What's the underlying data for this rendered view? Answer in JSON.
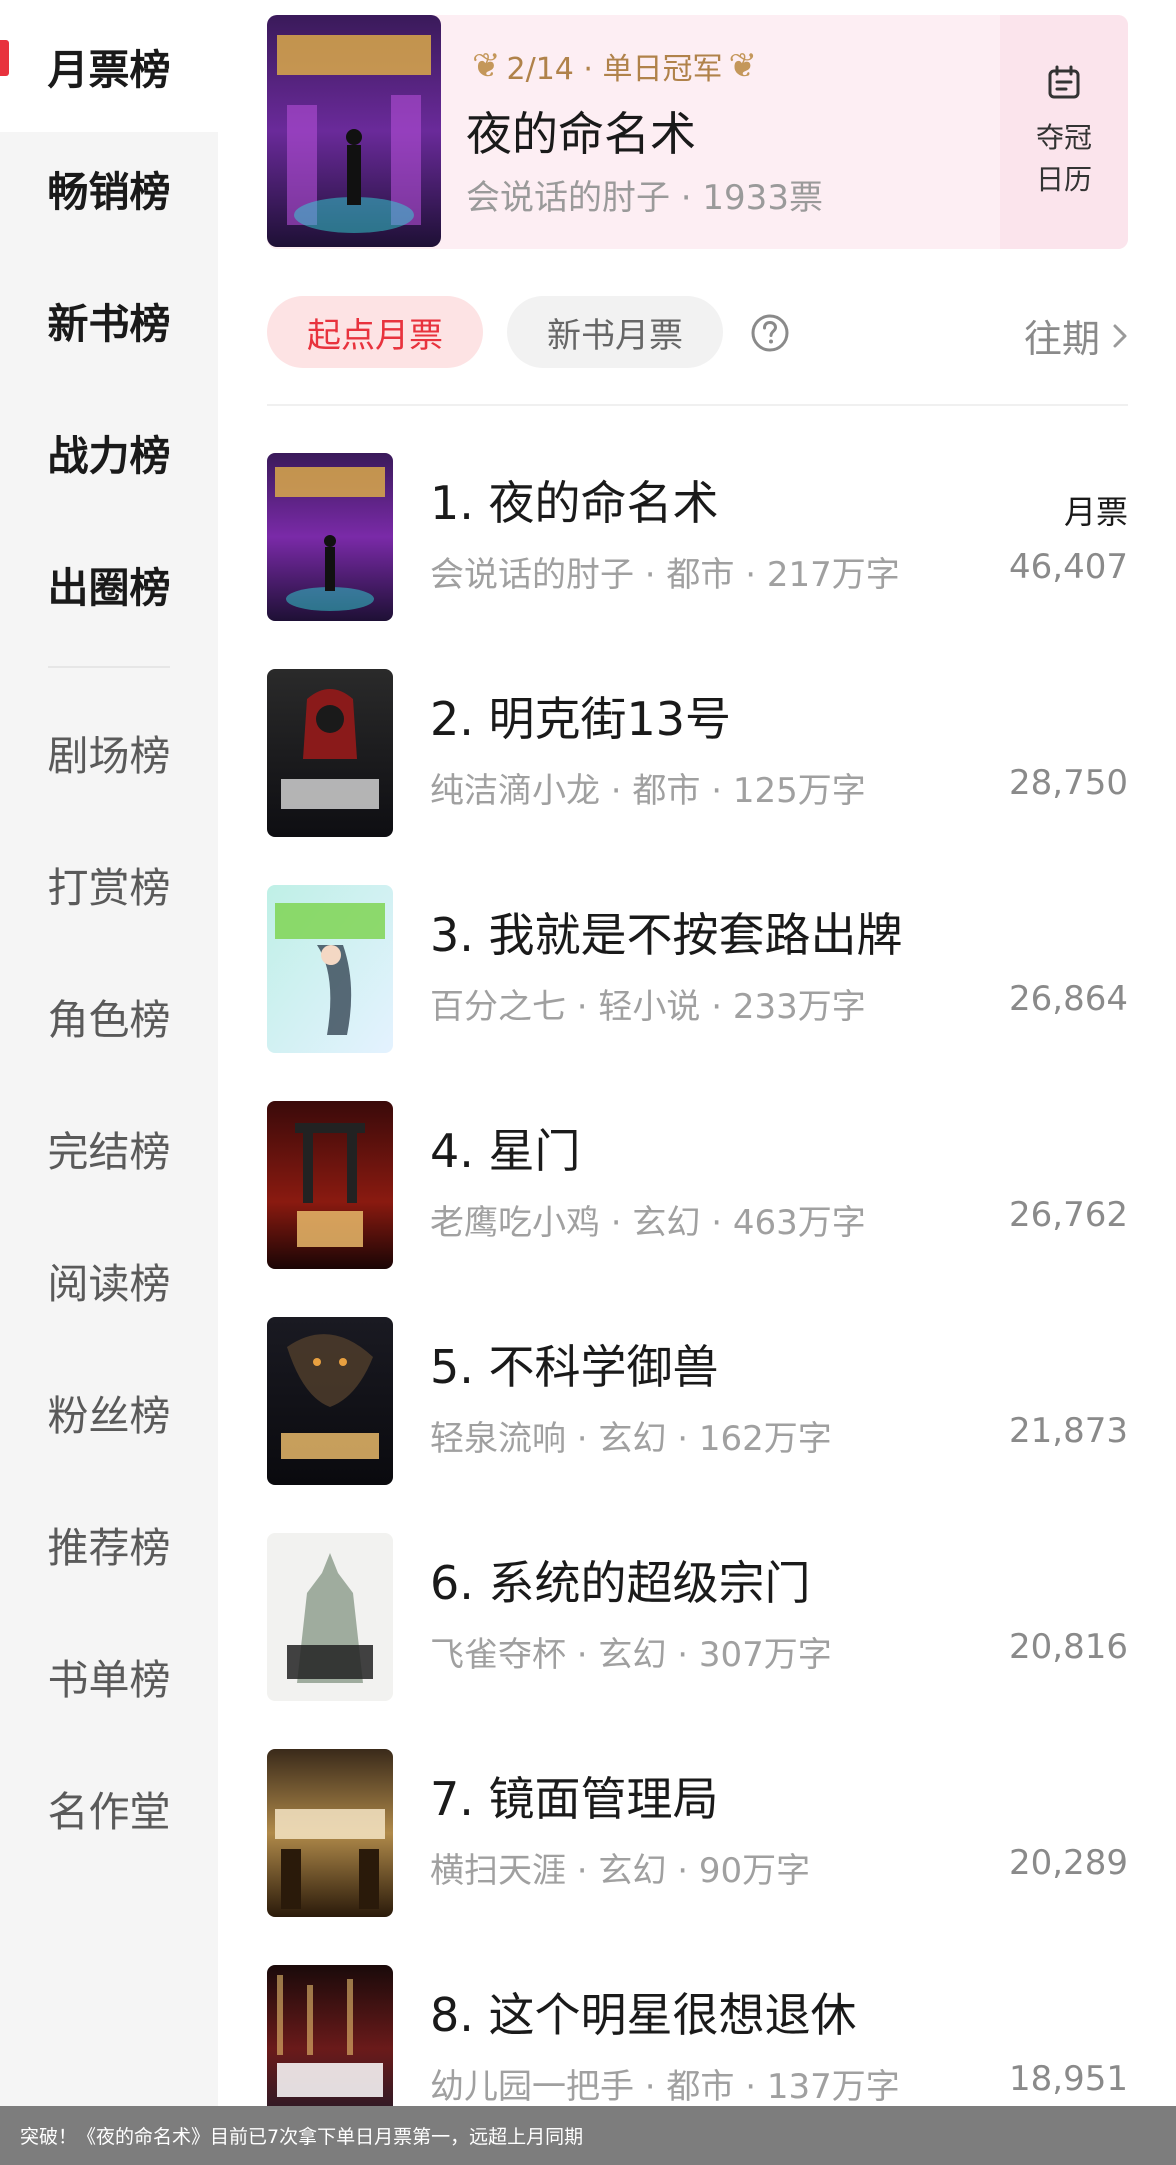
{
  "sidebar": {
    "items": [
      {
        "label": "月票榜"
      },
      {
        "label": "畅销榜"
      },
      {
        "label": "新书榜"
      },
      {
        "label": "战力榜"
      },
      {
        "label": "出圈榜"
      },
      {
        "label": "剧场榜"
      },
      {
        "label": "打赏榜"
      },
      {
        "label": "角色榜"
      },
      {
        "label": "完结榜"
      },
      {
        "label": "阅读榜"
      },
      {
        "label": "粉丝榜"
      },
      {
        "label": "推荐榜"
      },
      {
        "label": "书单榜"
      },
      {
        "label": "名作堂"
      }
    ],
    "accent": "#e8323d"
  },
  "champion": {
    "badge": "2/14 · 单日冠军",
    "title": "夜的命名术",
    "subtitle": "会说话的肘子 · 1933票",
    "calendar_line1": "夺冠",
    "calendar_line2": "日历",
    "calendar_icon": "calendar-icon"
  },
  "tabs": {
    "qidian": "起点月票",
    "newbook": "新书月票",
    "history": "往期",
    "help_icon": "question-circle-icon"
  },
  "list": {
    "vote_header": "月票",
    "items": [
      {
        "title": "1. 夜的命名术",
        "meta": "会说话的肘子 · 都市 · 217万字",
        "votes": "46,407"
      },
      {
        "title": "2. 明克街13号",
        "meta": "纯洁滴小龙 · 都市 · 125万字",
        "votes": "28,750"
      },
      {
        "title": "3. 我就是不按套路出牌",
        "meta": "百分之七 · 轻小说 · 233万字",
        "votes": "26,864"
      },
      {
        "title": "4. 星门",
        "meta": "老鹰吃小鸡 · 玄幻 · 463万字",
        "votes": "26,762"
      },
      {
        "title": "5. 不科学御兽",
        "meta": "轻泉流响 · 玄幻 · 162万字",
        "votes": "21,873"
      },
      {
        "title": "6. 系统的超级宗门",
        "meta": "飞雀夺杯 · 玄幻 · 307万字",
        "votes": "20,816"
      },
      {
        "title": "7. 镜面管理局",
        "meta": "横扫天涯 · 玄幻 · 90万字",
        "votes": "20,289"
      },
      {
        "title": "8. 这个明星很想退休",
        "meta": "幼儿园一把手 · 都市 · 137万字",
        "votes": "18,951"
      }
    ]
  },
  "toast": "突破！《夜的命名术》目前已7次拿下单日月票第一，远超上月同期"
}
